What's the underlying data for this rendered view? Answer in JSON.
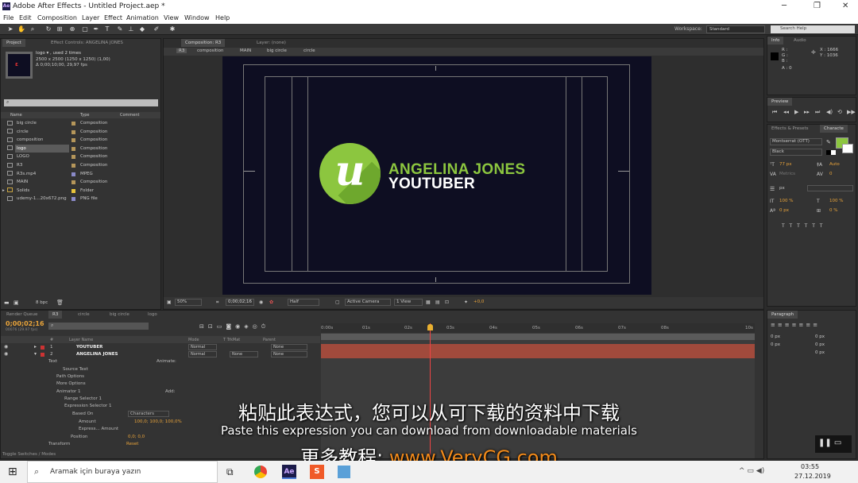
{
  "app": {
    "title": "Adobe After Effects - Untitled Project.aep *",
    "icon": "Ae"
  },
  "menu": [
    "File",
    "Edit",
    "Composition",
    "Layer",
    "Effect",
    "Animation",
    "View",
    "Window",
    "Help"
  ],
  "workspace": {
    "label": "Workspace:",
    "value": "Standard",
    "search_placeholder": "Search Help"
  },
  "project_panel": {
    "tab": "Project",
    "effects_tab": "Effect Controls: ANGELINA JONES",
    "selected_name": "logo ▾ , used 2 times",
    "dims": "2500 x 2500  (1250 x 1250) (1,00)",
    "duration": "Δ 0;00;10;00, 29,97 fps",
    "columns": [
      "Name",
      "Type",
      "Comment"
    ],
    "items": [
      {
        "name": "big circle",
        "type": "Composition",
        "color": "#b5965a"
      },
      {
        "name": "circle",
        "type": "Composition",
        "color": "#b5965a"
      },
      {
        "name": "composition",
        "type": "Composition",
        "color": "#b5965a"
      },
      {
        "name": "logo",
        "type": "Composition",
        "color": "#b5965a"
      },
      {
        "name": "LOGO",
        "type": "Composition",
        "color": "#b5965a"
      },
      {
        "name": "R3",
        "type": "Composition",
        "color": "#b5965a"
      },
      {
        "name": "R3s.mp4",
        "type": "MPEG",
        "color": "#8a8ac8"
      },
      {
        "name": "MAIN",
        "type": "Composition",
        "color": "#b5965a"
      },
      {
        "name": "Solids",
        "type": "Folder",
        "color": "#e8c33a"
      },
      {
        "name": "udemy-1...20x672.png",
        "type": "PNG file",
        "color": "#8a8ac8"
      }
    ],
    "bpc": "8 bpc"
  },
  "comp_panel": {
    "tab": "Composition: R3",
    "layer_tab": "Layer: (none)",
    "breadcrumb": [
      "R3",
      "composition",
      "MAIN",
      "big circle",
      "circle"
    ],
    "zoom": "50%",
    "time": "0;00;02;16",
    "resolution": "Half",
    "camera": "Active Camera",
    "views": "1 View",
    "exposure": "+0,0"
  },
  "logo": {
    "line1": "ANGELINA JONES",
    "line2": "YOUTUBER",
    "accent": "#8cc63f"
  },
  "info_panel": {
    "tab": "Info",
    "audio_tab": "Audio",
    "R": "R :",
    "G": "G :",
    "B": "B :",
    "A": "A : 0",
    "X": "X : 1666",
    "Y": "Y : 1036"
  },
  "preview_panel": {
    "tab": "Preview"
  },
  "character_panel": {
    "tab1": "Effects & Presets",
    "tab2": "Characte",
    "font": "Montserrat (OTT)",
    "style": "Black",
    "size": "77 px",
    "leading": "Auto",
    "tracking": "0",
    "stroke": "px",
    "scaleV": "100 %",
    "scaleH": "100 %",
    "baseline": "0 px",
    "tsume": "0 %",
    "kerning": "Metrics"
  },
  "paragraph_panel": {
    "tab": "Paragraph",
    "indent1": "0 px",
    "indent2": "0 px",
    "indent3": "0 px",
    "space1": "0 px",
    "space2": "0 px"
  },
  "timeline": {
    "tabs": [
      "Render Queue",
      "R3",
      "circle",
      "big circle",
      "logo"
    ],
    "time": "0;00;02;16",
    "fps": "00076 (29.97 fps)",
    "headers": [
      "#",
      "Layer Name",
      "Mode",
      "T TrkMat",
      "Parent"
    ],
    "layers": [
      {
        "num": "1",
        "name": "YOUTUBER",
        "mode": "Normal",
        "trkmat": "",
        "parent": "None"
      },
      {
        "num": "2",
        "name": "ANGELINA JONES",
        "mode": "Normal",
        "trkmat": "None",
        "parent": "None"
      }
    ],
    "props": [
      {
        "label": "Text",
        "extra": "Animate:"
      },
      {
        "label": "Source Text"
      },
      {
        "label": "Path Options"
      },
      {
        "label": "More Options"
      },
      {
        "label": "Animator 1",
        "extra": "Add:"
      },
      {
        "label": "Range Selector 1"
      },
      {
        "label": "Expression Selector 1"
      },
      {
        "label": "Based On",
        "value": "Characters"
      },
      {
        "label": "Amount",
        "value": "100,0; 100,0; 100,0%"
      },
      {
        "label": "Express... Amount"
      },
      {
        "label": "Position",
        "value": "0,0; 0,0"
      },
      {
        "label": "Transform",
        "value": "Reset"
      }
    ],
    "ruler": [
      "0:00s",
      "01s",
      "02s",
      "03s",
      "04s",
      "05s",
      "06s",
      "07s",
      "08s",
      "10s"
    ],
    "toggle": "Toggle Switches / Modes"
  },
  "subtitles": {
    "zh": "粘贴此表达式，您可以从可下载的资料中下载",
    "en": "Paste this expression you can download from downloadable materials",
    "promo_zh": "更多教程: ",
    "promo_url": "www.VeryCG.com"
  },
  "taskbar": {
    "search": "Aramak için buraya yazın",
    "time": "03:55",
    "date": "27.12.2019"
  }
}
